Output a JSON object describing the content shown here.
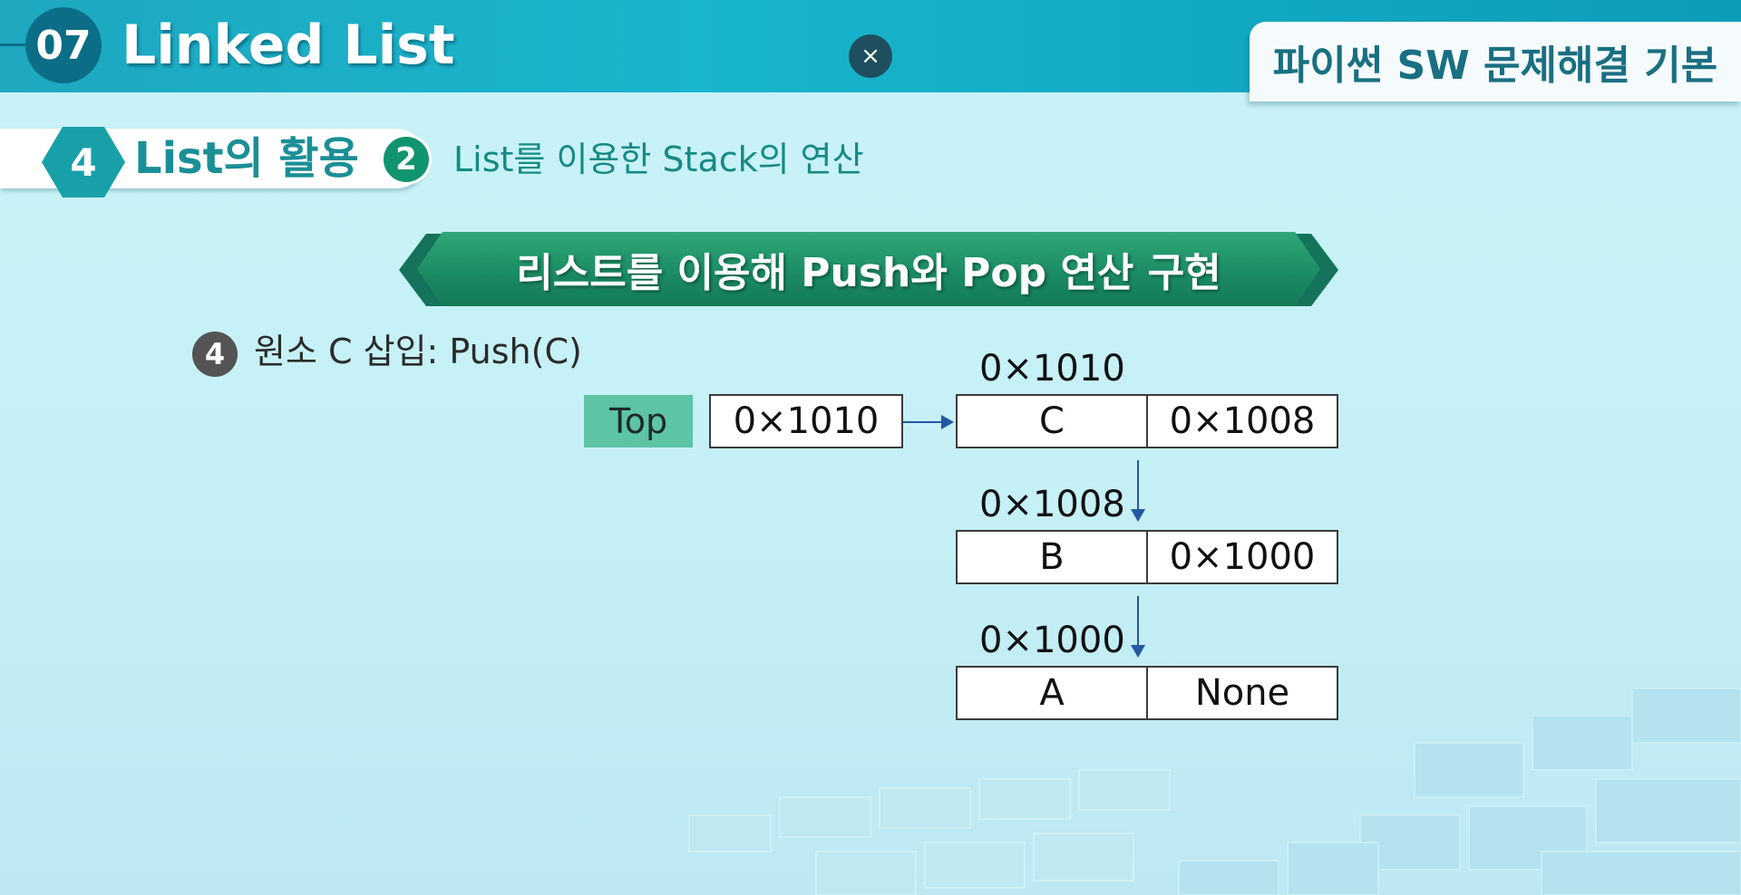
{
  "header": {
    "chapter_number": "07",
    "chapter_title": "Linked List",
    "close_symbol": "×",
    "course_title": "파이썬 SW 문제해결 기본"
  },
  "section": {
    "number": "4",
    "title": "List의 활용",
    "sub_number": "2",
    "sub_title": "List를 이용한 Stack의 연산"
  },
  "banner": {
    "text": "리스트를 이용해 Push와 Pop 연산 구현"
  },
  "step": {
    "number": "4",
    "text": "원소 C 삽입: Push(C)"
  },
  "diagram": {
    "top_label": "Top",
    "top_value": "0×1010",
    "nodes": [
      {
        "address": "0×1010",
        "data": "C",
        "link": "0×1008"
      },
      {
        "address": "0×1008",
        "data": "B",
        "link": "0×1000"
      },
      {
        "address": "0×1000",
        "data": "A",
        "link": "None"
      }
    ]
  },
  "colors": {
    "header_teal": "#19b5cc",
    "chapter_circle": "#0b6d86",
    "banner_green": "#1a8a62",
    "top_label_green": "#5dc4a6",
    "arrow_blue": "#2357a3",
    "step_circle_gray": "#545454"
  },
  "icons": {
    "close": "close-icon"
  }
}
